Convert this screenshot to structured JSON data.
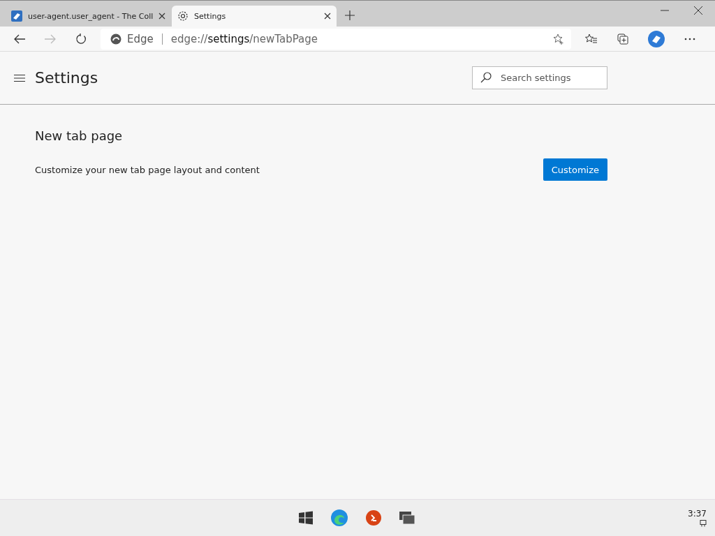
{
  "tabs": [
    {
      "kind": "site",
      "title": "user-agent.user_agent - The Coll",
      "selected": false
    },
    {
      "kind": "settings",
      "title": "Settings",
      "selected": true
    }
  ],
  "address_bar": {
    "site_label": "Edge",
    "url_scheme": "edge://",
    "url_host": "settings",
    "url_path": "/newTabPage"
  },
  "header": {
    "title": "Settings",
    "search": {
      "placeholder": "Search settings"
    }
  },
  "section": {
    "title": "New tab page",
    "description": "Customize your new tab page layout and content",
    "button": "Customize"
  },
  "taskbar": {
    "apps": [
      {
        "kind": "start"
      },
      {
        "kind": "edge"
      },
      {
        "kind": "remote"
      },
      {
        "kind": "taskview"
      }
    ],
    "clock": "3:37"
  }
}
